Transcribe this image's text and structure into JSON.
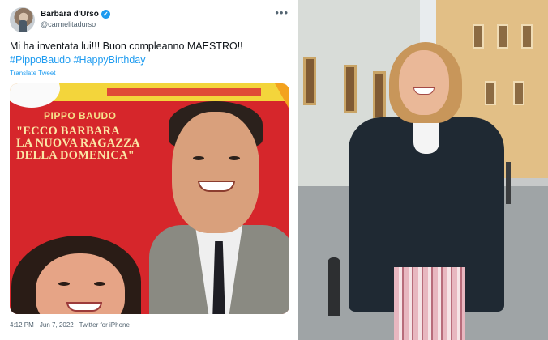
{
  "tweet": {
    "display_name": "Barbara d'Urso",
    "verified_mark": "✓",
    "handle": "@carmelitadurso",
    "more_icon": "•••",
    "text_plain": "Mi ha inventata lui!!! Buon compleanno MAESTRO!!",
    "hashtags": [
      "#PippoBaudo",
      "#HappyBirthday"
    ],
    "translate_label": "Translate Tweet",
    "meta": "4:12 PM · Jun 7, 2022 · Twitter for iPhone",
    "media": {
      "cover_name": "PIPPO BAUDO",
      "cover_headline_lines": [
        "\"ECCO BARBARA",
        "LA NUOVA RAGAZZA",
        "DELLA DOMENICA\""
      ]
    }
  },
  "colors": {
    "accent": "#1d9bf0",
    "text": "#0f1419",
    "muted": "#536471",
    "cover_red": "#d6262b"
  }
}
